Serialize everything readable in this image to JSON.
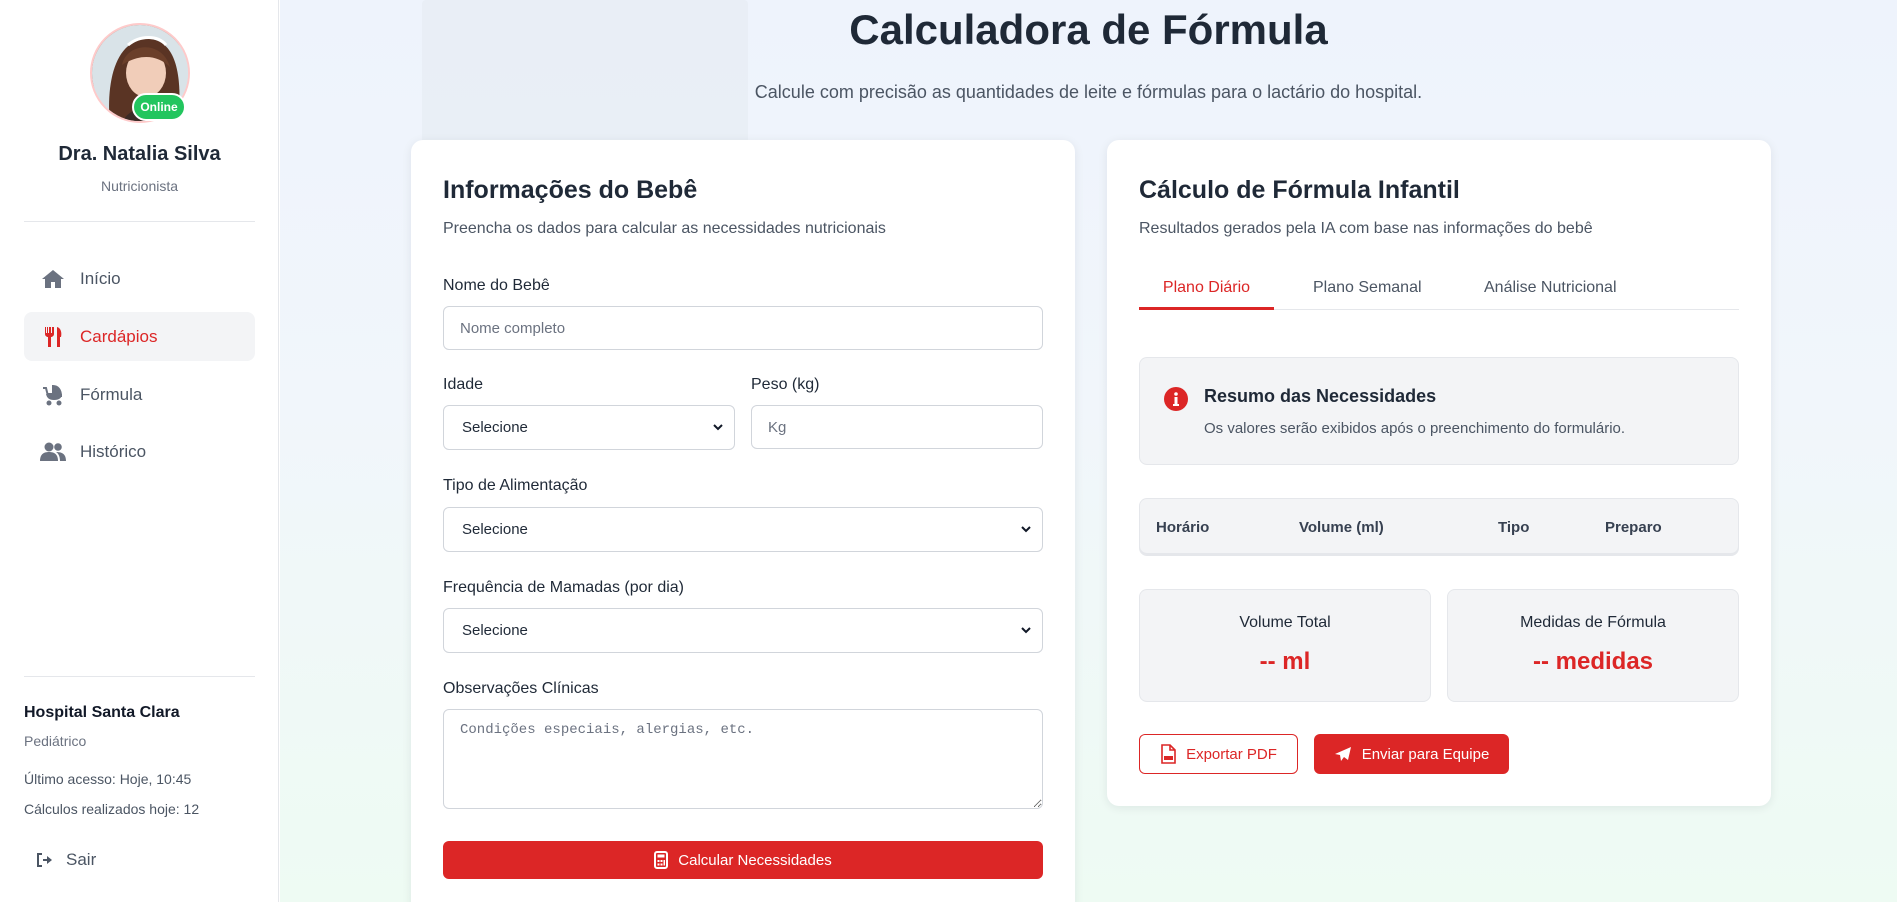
{
  "profile": {
    "status": "Online",
    "name": "Dra. Natalia Silva",
    "role": "Nutricionista"
  },
  "nav": {
    "items": [
      {
        "label": "Início",
        "icon": "home-icon"
      },
      {
        "label": "Cardápios",
        "icon": "utensils-icon"
      },
      {
        "label": "Fórmula",
        "icon": "baby-carriage-icon"
      },
      {
        "label": "Histórico",
        "icon": "users-icon"
      }
    ],
    "active": "Cardápios"
  },
  "hospital": {
    "name": "Hospital Santa Clara",
    "department": "Pediátrico",
    "last_access": "Último acesso: Hoje, 10:45",
    "calculations_today": "Cálculos realizados hoje: 12"
  },
  "logout_label": "Sair",
  "header": {
    "title": "Calculadora de Fórmula",
    "subtitle": "Calcule com precisão as quantidades de leite e fórmulas para o lactário do hospital."
  },
  "form": {
    "title": "Informações do Bebê",
    "subtitle": "Preencha os dados para calcular as necessidades nutricionais",
    "name_label": "Nome do Bebê",
    "name_placeholder": "Nome completo",
    "age_label": "Idade",
    "age_value": "Selecione",
    "weight_label": "Peso (kg)",
    "weight_placeholder": "Kg",
    "feeding_label": "Tipo de Alimentação",
    "feeding_value": "Selecione",
    "frequency_label": "Frequência de Mamadas (por dia)",
    "frequency_value": "Selecione",
    "notes_label": "Observações Clínicas",
    "notes_placeholder": "Condições especiais, alergias, etc.",
    "submit_label": "Calcular Necessidades"
  },
  "results": {
    "title": "Cálculo de Fórmula Infantil",
    "subtitle": "Resultados gerados pela IA com base nas informações do bebê",
    "tabs": [
      "Plano Diário",
      "Plano Semanal",
      "Análise Nutricional"
    ],
    "active_tab": "Plano Diário",
    "summary_title": "Resumo das Necessidades",
    "summary_text": "Os valores serão exibidos após o preenchimento do formulário.",
    "table_headers": [
      "Horário",
      "Volume (ml)",
      "Tipo",
      "Preparo"
    ],
    "total_volume_label": "Volume Total",
    "total_volume_value": "-- ml",
    "formula_measures_label": "Medidas de Fórmula",
    "formula_measures_value": "-- medidas",
    "export_label": "Exportar PDF",
    "send_label": "Enviar para Equipe"
  },
  "colors": {
    "accent": "#dc2626",
    "online": "#22c55e",
    "text": "#1f2937",
    "muted": "#6b7280"
  }
}
